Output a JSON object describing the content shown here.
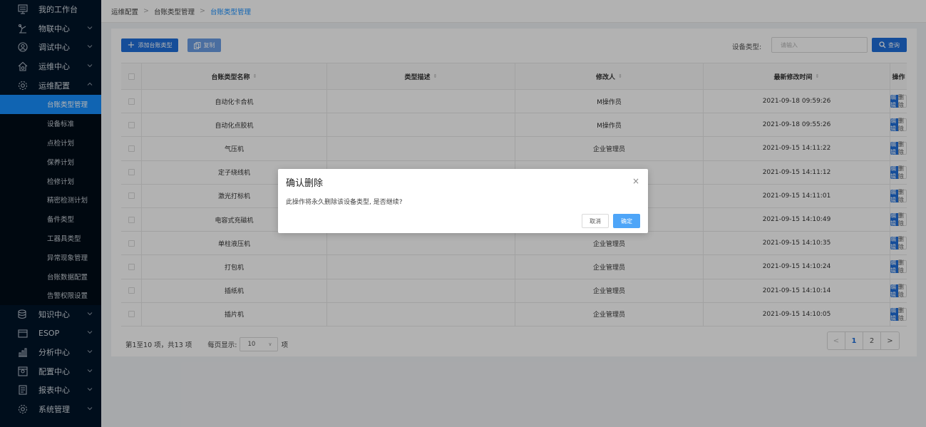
{
  "sidebar": {
    "menus_top": [
      {
        "label": "我的工作台",
        "icon": "monitor-icon",
        "arrow": false
      },
      {
        "label": "物联中心",
        "icon": "robot-arm-icon",
        "arrow": true
      },
      {
        "label": "调试中心",
        "icon": "person-search-icon",
        "arrow": true
      },
      {
        "label": "运维中心",
        "icon": "home-gear-icon",
        "arrow": true
      },
      {
        "label": "运维配置",
        "icon": "gear-icon",
        "arrow": true
      }
    ],
    "sub_items": [
      {
        "label": "台账类型管理",
        "active": true
      },
      {
        "label": "设备标准",
        "active": false
      },
      {
        "label": "点检计划",
        "active": false
      },
      {
        "label": "保养计划",
        "active": false
      },
      {
        "label": "检修计划",
        "active": false
      },
      {
        "label": "精密检测计划",
        "active": false
      },
      {
        "label": "备件类型",
        "active": false
      },
      {
        "label": "工器具类型",
        "active": false
      },
      {
        "label": "异常现象管理",
        "active": false
      },
      {
        "label": "台账数据配置",
        "active": false
      },
      {
        "label": "告警权限设置",
        "active": false
      }
    ],
    "menus_bottom": [
      {
        "label": "知识中心",
        "icon": "database-icon"
      },
      {
        "label": "ESOP",
        "icon": "esop-icon"
      },
      {
        "label": "分析中心",
        "icon": "bar-chart-icon"
      },
      {
        "label": "配置中心",
        "icon": "config-icon"
      },
      {
        "label": "报表中心",
        "icon": "report-icon"
      },
      {
        "label": "系统管理",
        "icon": "settings-icon"
      }
    ]
  },
  "breadcrumb": {
    "level1": "运维配置",
    "level2": "台账类型管理",
    "level3": "台账类型管理"
  },
  "toolbar": {
    "add_label": "添加台账类型",
    "copy_label": "复制",
    "filter_label": "设备类型:",
    "filter_placeholder": "请输入",
    "search_label": "查询"
  },
  "table": {
    "headers": [
      "台账类型名称",
      "类型描述",
      "修改人",
      "最新修改时间",
      "操作"
    ],
    "edit_label": "编辑",
    "delete_label": "删除",
    "rows": [
      {
        "name": "自动化卡合机",
        "desc": "",
        "modifier": "M操作员",
        "time": "2021-09-18 09:59:26"
      },
      {
        "name": "自动化点胶机",
        "desc": "",
        "modifier": "M操作员",
        "time": "2021-09-18 09:55:26"
      },
      {
        "name": "气压机",
        "desc": "",
        "modifier": "企业管理员",
        "time": "2021-09-15 14:11:22"
      },
      {
        "name": "定子绕线机",
        "desc": "",
        "modifier": "",
        "time": "2021-09-15 14:11:12"
      },
      {
        "name": "激光打标机",
        "desc": "",
        "modifier": "",
        "time": "2021-09-15 14:11:01"
      },
      {
        "name": "电容式充磁机",
        "desc": "",
        "modifier": "",
        "time": "2021-09-15 14:10:49"
      },
      {
        "name": "单柱液压机",
        "desc": "",
        "modifier": "企业管理员",
        "time": "2021-09-15 14:10:35"
      },
      {
        "name": "打包机",
        "desc": "",
        "modifier": "企业管理员",
        "time": "2021-09-15 14:10:24"
      },
      {
        "name": "插纸机",
        "desc": "",
        "modifier": "企业管理员",
        "time": "2021-09-15 14:10:14"
      },
      {
        "name": "插片机",
        "desc": "",
        "modifier": "企业管理员",
        "time": "2021-09-15 14:10:05"
      }
    ]
  },
  "footer": {
    "range_text": "第1至10 项，共13 项",
    "page_size_label": "每页显示:",
    "page_size_value": "10",
    "item_unit": "项"
  },
  "pager": {
    "prev": "<",
    "pages": [
      "1",
      "2"
    ],
    "current": "1",
    "next": ">"
  },
  "modal": {
    "title": "确认删除",
    "message": "此操作将永久删除该设备类型, 是否继续?",
    "cancel_label": "取消",
    "ok_label": "确定",
    "close": "×"
  },
  "colors": {
    "sidebar_bg": "#001529",
    "primary": "#1f6fdb",
    "active_menu": "#1890ff",
    "ok_button": "#4ea5f8"
  }
}
